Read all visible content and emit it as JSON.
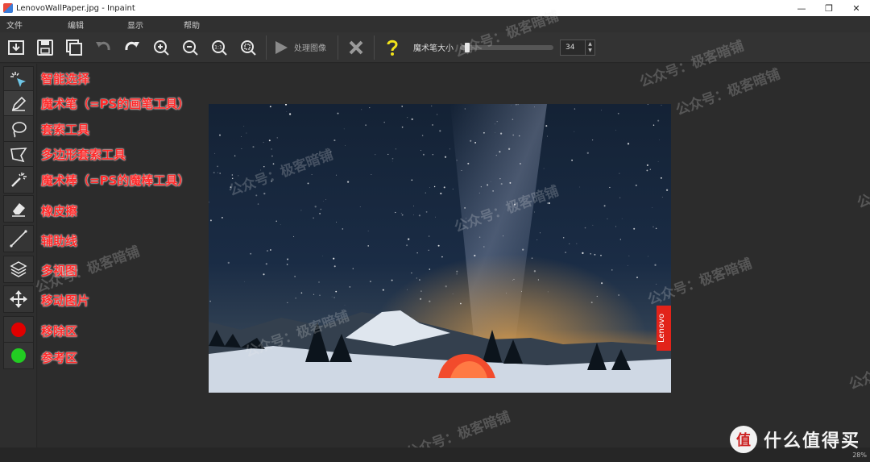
{
  "window": {
    "title": "LenovoWallPaper.jpg - Inpaint",
    "minimize": "—",
    "restore": "❐",
    "close": "✕"
  },
  "menu": [
    "文件",
    "编辑",
    "显示",
    "帮助"
  ],
  "toolbar": {
    "buttons": [
      "save-as-icon",
      "save-icon",
      "duplicate-icon",
      "undo-icon",
      "redo-icon",
      "zoom-in-icon",
      "zoom-out-icon",
      "zoom-actual-icon",
      "zoom-fit-icon"
    ],
    "process_label": "处理图像",
    "brush_size_label": "魔术笔大小",
    "brush_size_value": "34",
    "brush_size_fraction": 0.08
  },
  "tools": [
    {
      "name": "smart-select",
      "icon": "magic-pointer-icon",
      "label": "智能选择"
    },
    {
      "name": "magic-pen",
      "icon": "pen-icon",
      "label": "魔术笔（=PS的画笔工具）"
    },
    {
      "name": "lasso",
      "icon": "lasso-icon",
      "label": "套索工具"
    },
    {
      "name": "polygon-lasso",
      "icon": "polygon-lasso-icon",
      "label": "多边形套索工具"
    },
    {
      "name": "magic-wand",
      "icon": "magic-wand-icon",
      "label": "魔术棒（=PS的魔棒工具）"
    },
    {
      "name": "eraser",
      "icon": "eraser-icon",
      "label": "橡皮擦"
    },
    {
      "name": "guide-line",
      "icon": "line-icon",
      "label": "辅助线"
    },
    {
      "name": "multi-view",
      "icon": "layers-icon",
      "label": "多视图"
    },
    {
      "name": "move-image",
      "icon": "move-icon",
      "label": "移动图片"
    },
    {
      "name": "remove-area",
      "icon": "red-dot-icon",
      "label": "移除区"
    },
    {
      "name": "reference-area",
      "icon": "green-dot-icon",
      "label": "参考区"
    }
  ],
  "colors": {
    "remove": "#e00000",
    "reference": "#22cc22",
    "annotation": "#ff2a2a"
  },
  "photo": {
    "brand_tag": "Lenovo"
  },
  "status": {
    "zoom": "28%"
  },
  "watermarks": {
    "text": "公众号：极客暗铺"
  },
  "brand": {
    "logo": "值",
    "text": "什么值得买"
  }
}
